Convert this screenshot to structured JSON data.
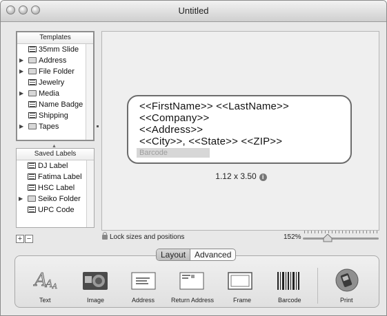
{
  "window": {
    "title": "Untitled"
  },
  "templates": {
    "header": "Templates",
    "items": [
      {
        "label": "35mm Slide",
        "kind": "doc"
      },
      {
        "label": "Address",
        "kind": "folder"
      },
      {
        "label": "File Folder",
        "kind": "folder"
      },
      {
        "label": "Jewelry",
        "kind": "doc"
      },
      {
        "label": "Media",
        "kind": "folder"
      },
      {
        "label": "Name Badge",
        "kind": "doc"
      },
      {
        "label": "Shipping",
        "kind": "doc"
      },
      {
        "label": "Tapes",
        "kind": "folder"
      }
    ]
  },
  "saved_labels": {
    "header": "Saved Labels",
    "items": [
      {
        "label": "DJ Label",
        "kind": "doc"
      },
      {
        "label": "Fatima Label",
        "kind": "doc"
      },
      {
        "label": "HSC Label",
        "kind": "doc"
      },
      {
        "label": "Seiko Folder",
        "kind": "folder"
      },
      {
        "label": "UPC Code",
        "kind": "doc"
      }
    ]
  },
  "label": {
    "lines": [
      "<<FirstName>> <<LastName>>",
      "<<Company>>",
      "<<Address>>",
      "<<City>>, <<State>> <<ZIP>>"
    ],
    "barcode_placeholder": "Barcode",
    "dimensions": "1.12 x 3.50"
  },
  "bottom_bar": {
    "add_symbol": "+",
    "remove_symbol": "−",
    "lock_text": "Lock sizes and positions",
    "zoom_value": "152%",
    "zoom_level": 0.3
  },
  "tabs": {
    "layout": "Layout",
    "advanced": "Advanced",
    "active": "Layout"
  },
  "tools": [
    {
      "label": "Text",
      "icon": "text-tool-icon"
    },
    {
      "label": "Image",
      "icon": "image-tool-icon"
    },
    {
      "label": "Address",
      "icon": "address-tool-icon"
    },
    {
      "label": "Return Address",
      "icon": "return-address-tool-icon"
    },
    {
      "label": "Frame",
      "icon": "frame-tool-icon"
    },
    {
      "label": "Barcode",
      "icon": "barcode-tool-icon"
    },
    {
      "label": "Print",
      "icon": "print-tool-icon"
    }
  ]
}
